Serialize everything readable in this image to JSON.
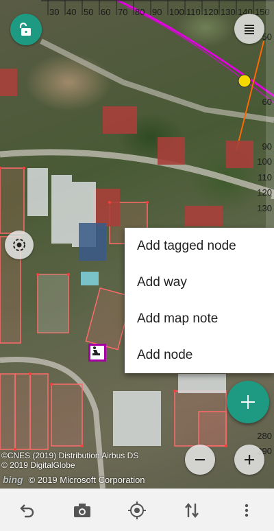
{
  "map": {
    "ruler_top": [
      "30",
      "40",
      "50",
      "60",
      "70",
      "80",
      "90",
      "100",
      "110",
      "120",
      "130",
      "140",
      "150"
    ],
    "ruler_right": [
      "50",
      "60",
      "90",
      "100",
      "110",
      "120",
      "130",
      "280",
      "290"
    ],
    "attribution": {
      "line1": "©CNES (2019) Distribution Airbus DS",
      "line2": "© 2019 DigitalGlobe",
      "bing_label": "bing",
      "microsoft": "© 2019 Microsoft Corporation"
    }
  },
  "controls": {
    "lock_icon": "unlock-icon",
    "layers_icon": "menu-icon",
    "gps_icon": "gps-icon",
    "add_icon": "plus-icon",
    "zoom_out_icon": "minus-icon",
    "zoom_in_icon": "plus-icon",
    "accent_color": "#1f9a82"
  },
  "context_menu": {
    "items": [
      "Add tagged node",
      "Add way",
      "Add map note",
      "Add node"
    ]
  },
  "toolbar": {
    "icons": [
      "undo-icon",
      "camera-icon",
      "gps-follow-icon",
      "transfer-icon",
      "more-icon"
    ]
  }
}
